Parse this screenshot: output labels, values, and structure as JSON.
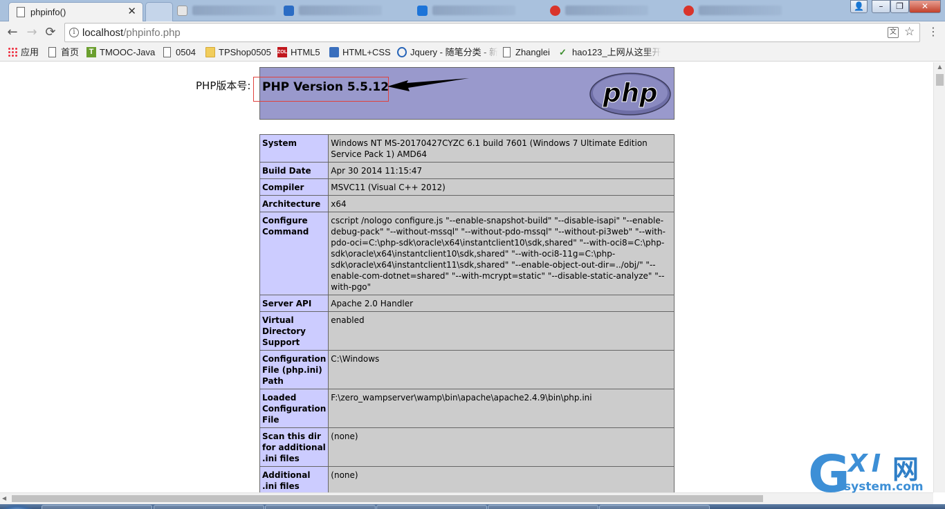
{
  "browser": {
    "active_tab": {
      "title": "phpinfo()",
      "close_glyph": "✕"
    },
    "url": {
      "host": "localhost",
      "path": "/phpinfo.php"
    },
    "nav": {
      "back_glyph": "←",
      "forward_glyph": "→",
      "reload_glyph": "⟳"
    },
    "omnibox_icons": {
      "info_glyph": "i",
      "translate_glyph": "文",
      "star_glyph": "☆",
      "menu_glyph": "⋮"
    },
    "window_controls": {
      "user_glyph": "👤",
      "min_glyph": "–",
      "max_glyph": "❐",
      "close_glyph": "✕"
    },
    "bookmarks": [
      {
        "label": "应用",
        "icon": "apps-grid-icon"
      },
      {
        "label": "首页",
        "icon": "page-icon"
      },
      {
        "label": "TMOOC-Java",
        "icon": "tmooc-icon"
      },
      {
        "label": "0504",
        "icon": "page-icon"
      },
      {
        "label": "TPShop0505",
        "icon": "folder-icon"
      },
      {
        "label": "HTML5",
        "icon": "zol-icon"
      },
      {
        "label": "HTML+CSS",
        "icon": "cnblogs-icon"
      },
      {
        "label": "Jquery - 随笔分类 - 新",
        "icon": "blog-icon"
      },
      {
        "label": "Zhanglei",
        "icon": "page-icon"
      },
      {
        "label": "hao123_上网从这里开",
        "icon": "hao123-icon"
      }
    ]
  },
  "page": {
    "annotation": "PHP版本号:",
    "version_title": "PHP Version 5.5.12",
    "logo_text": "php",
    "rows": [
      {
        "key": "System",
        "value": "Windows NT MS-20170427CYZC 6.1 build 7601 (Windows 7 Ultimate Edition Service Pack 1) AMD64"
      },
      {
        "key": "Build Date",
        "value": "Apr 30 2014 11:15:47"
      },
      {
        "key": "Compiler",
        "value": "MSVC11 (Visual C++ 2012)"
      },
      {
        "key": "Architecture",
        "value": "x64"
      },
      {
        "key": "Configure Command",
        "value": "cscript /nologo configure.js \"--enable-snapshot-build\" \"--disable-isapi\" \"--enable-debug-pack\" \"--without-mssql\" \"--without-pdo-mssql\" \"--without-pi3web\" \"--with-pdo-oci=C:\\php-sdk\\oracle\\x64\\instantclient10\\sdk,shared\" \"--with-oci8=C:\\php-sdk\\oracle\\x64\\instantclient10\\sdk,shared\" \"--with-oci8-11g=C:\\php-sdk\\oracle\\x64\\instantclient11\\sdk,shared\" \"--enable-object-out-dir=../obj/\" \"--enable-com-dotnet=shared\" \"--with-mcrypt=static\" \"--disable-static-analyze\" \"--with-pgo\""
      },
      {
        "key": "Server API",
        "value": "Apache 2.0 Handler"
      },
      {
        "key": "Virtual Directory Support",
        "value": "enabled"
      },
      {
        "key": "Configuration File (php.ini) Path",
        "value": "C:\\Windows"
      },
      {
        "key": "Loaded Configuration File",
        "value": "F:\\zero_wampserver\\wamp\\bin\\apache\\apache2.4.9\\bin\\php.ini"
      },
      {
        "key": "Scan this dir for additional .ini files",
        "value": "(none)"
      },
      {
        "key": "Additional .ini files parsed",
        "value": "(none)"
      }
    ]
  },
  "scrollbars": {
    "up_glyph": "▲",
    "left_glyph": "◀"
  },
  "watermark": {
    "g": "G",
    "xi": "XI",
    "wang": "网",
    "domain": "system.com"
  },
  "colors": {
    "php_header": "#9999cc",
    "php_key_cell": "#ccccff",
    "php_value_cell": "#cccccc",
    "annotation_box": "#e0413d",
    "watermark_blue": "#3d8fd6"
  }
}
